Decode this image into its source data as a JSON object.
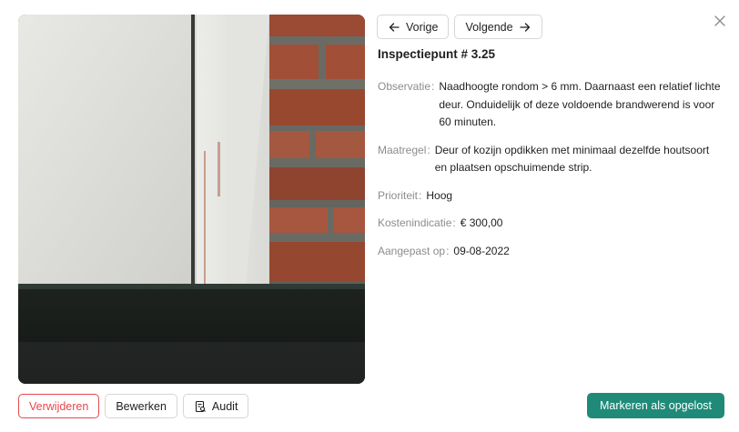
{
  "nav": {
    "prev_label": "Vorige",
    "next_label": "Volgende"
  },
  "inspection": {
    "title": "Inspectiepunt # 3.25",
    "fields": [
      {
        "label": "Observatie",
        "value": "Naadhoogte rondom > 6 mm. Daarnaast een relatief lichte deur. Onduidelijk of deze voldoende brandwerend is voor 60 minuten."
      },
      {
        "label": "Maatregel",
        "value": "Deur of kozijn opdikken met minimaal dezelfde houtsoort en plaatsen opschuimende strip."
      },
      {
        "label": "Prioriteit",
        "value": "Hoog"
      },
      {
        "label": "Kostenindicatie",
        "value": "€ 300,00"
      },
      {
        "label": "Aangepast op",
        "value": "09-08-2022"
      }
    ],
    "separator": ":"
  },
  "footer": {
    "delete_label": "Verwijderen",
    "edit_label": "Bewerken",
    "audit_label": "Audit",
    "resolve_label": "Markeren als opgelost"
  },
  "icons": {
    "close": "close-icon",
    "prev": "arrow-left-icon",
    "next": "arrow-right-icon",
    "audit": "audit-icon"
  },
  "colors": {
    "primary": "#1f8a78",
    "danger": "#e5484d",
    "label_muted": "#8c8c8c"
  }
}
